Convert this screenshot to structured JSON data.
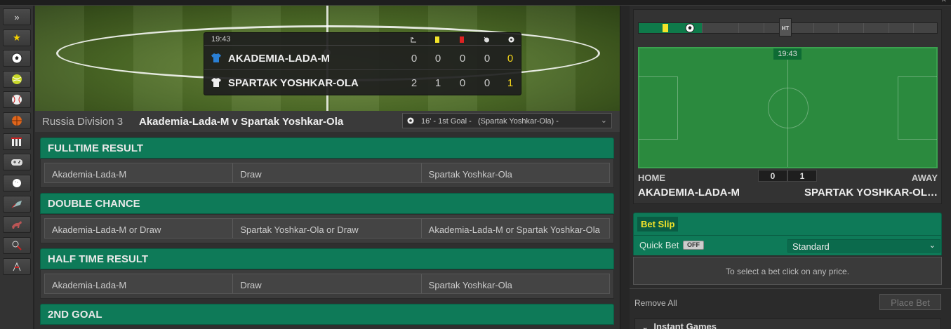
{
  "sidebar": {
    "items": [
      {
        "icon": "expand-icon",
        "glyph": "»"
      },
      {
        "icon": "star-icon",
        "glyph": "★"
      },
      {
        "icon": "soccer-ball-icon"
      },
      {
        "icon": "tennis-ball-icon"
      },
      {
        "icon": "baseball-icon"
      },
      {
        "icon": "basketball-icon"
      },
      {
        "icon": "cricket-icon"
      },
      {
        "icon": "gamepad-icon"
      },
      {
        "icon": "golf-icon"
      },
      {
        "icon": "darts-icon"
      },
      {
        "icon": "horse-racing-icon"
      },
      {
        "icon": "badminton-icon"
      },
      {
        "icon": "flag-icon"
      }
    ]
  },
  "scoreboard": {
    "time": "19:43",
    "teams": [
      {
        "name": "AKADEMIA-LADA-M",
        "shirt_color": "#2a7fd4",
        "corners": "0",
        "yellow": "0",
        "red": "0",
        "penalties": "0",
        "goals": "0"
      },
      {
        "name": "SPARTAK YOSHKAR-OLA",
        "shirt_color": "#eeeeee",
        "corners": "2",
        "yellow": "1",
        "red": "0",
        "penalties": "0",
        "goals": "1"
      }
    ]
  },
  "match": {
    "league": "Russia Division 3",
    "title": "Akademia-Lada-M v Spartak Yoshkar-Ola",
    "event_select": "16' - 1st Goal -   (Spartak Yoshkar-Ola) -"
  },
  "markets": [
    {
      "title": "FULLTIME RESULT",
      "options": [
        "Akademia-Lada-M",
        "Draw",
        "Spartak Yoshkar-Ola"
      ]
    },
    {
      "title": "DOUBLE CHANCE",
      "options": [
        "Akademia-Lada-M or Draw",
        "Spartak Yoshkar-Ola or Draw",
        "Akademia-Lada-M or Spartak Yoshkar-Ola"
      ]
    },
    {
      "title": "HALF TIME RESULT",
      "options": [
        "Akademia-Lada-M",
        "Draw",
        "Spartak Yoshkar-Ola"
      ]
    },
    {
      "title": "2ND GOAL",
      "options": []
    }
  ],
  "tracker": {
    "ht_label": "HT",
    "time": "19:43",
    "home_label": "HOME",
    "away_label": "AWAY",
    "home_score": "0",
    "away_score": "1",
    "home_name": "AKADEMIA-LADA-M",
    "away_name": "SPARTAK YOSHKAR-OL…"
  },
  "betslip": {
    "title": "Bet Slip",
    "quick_bet_label": "Quick Bet",
    "quick_bet_state": "OFF",
    "mode": "Standard",
    "message": "To select a bet click on any price.",
    "remove_all": "Remove All",
    "place_bet": "Place Bet"
  },
  "instant_games": "Instant Games",
  "colors": {
    "accent_green": "#0e7a58",
    "highlight_yellow": "#f2d41b"
  }
}
